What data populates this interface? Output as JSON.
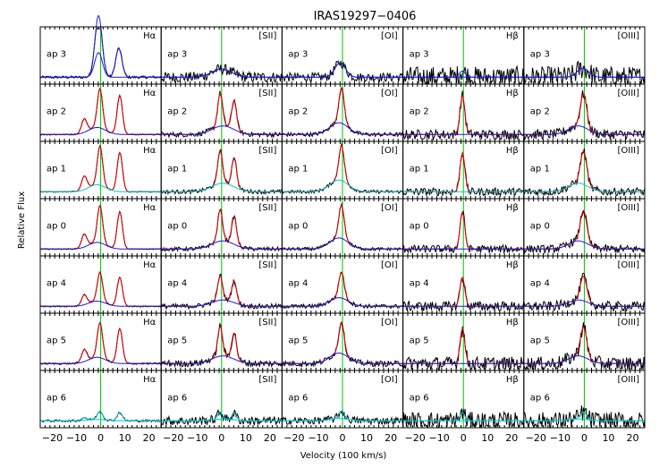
{
  "chart_data": {
    "type": "line",
    "title": "IRAS19297−0406",
    "xlabel": "Velocity (100 km/s)",
    "ylabel": "Relative Flux",
    "xlim": [
      -25,
      25
    ],
    "xticks": [
      -20,
      -10,
      0,
      10,
      20
    ],
    "xtick_labels": [
      "−20",
      "−10",
      "0",
      "10",
      "20"
    ],
    "columns": [
      "Hα",
      "[SII]",
      "[OI]",
      "Hβ",
      "[OIII]"
    ],
    "rows": [
      "ap 3",
      "ap 2",
      "ap 1",
      "ap 0",
      "ap 4",
      "ap 5",
      "ap 6"
    ],
    "systemic_velocity": 0,
    "colors": {
      "data": "#000000",
      "fit_narrow": "#e00000",
      "fit_broad": "#1a1adc",
      "fit_faint": "#00c8d0",
      "systemic": "#00c000"
    },
    "grid": false,
    "legend": "none"
  }
}
